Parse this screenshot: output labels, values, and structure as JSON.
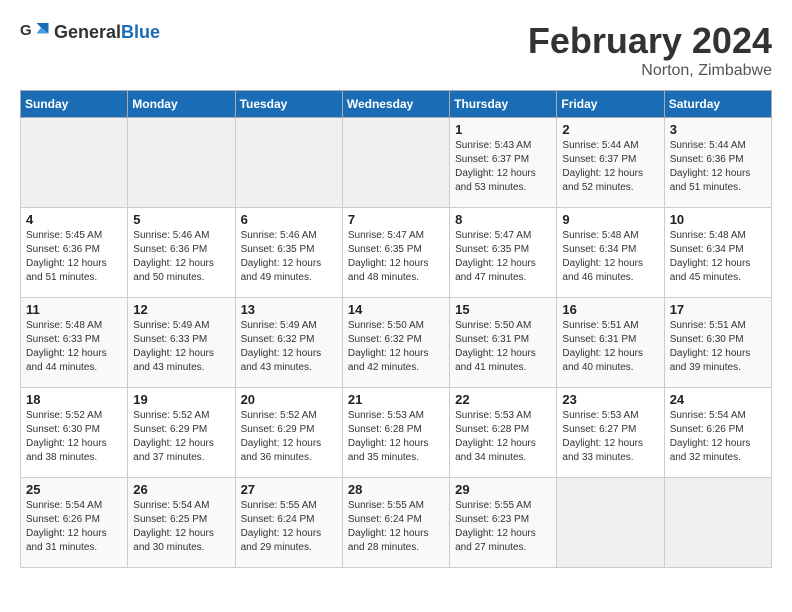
{
  "header": {
    "logo_general": "General",
    "logo_blue": "Blue",
    "month_title": "February 2024",
    "location": "Norton, Zimbabwe"
  },
  "days_of_week": [
    "Sunday",
    "Monday",
    "Tuesday",
    "Wednesday",
    "Thursday",
    "Friday",
    "Saturday"
  ],
  "weeks": [
    [
      {
        "day": "",
        "info": ""
      },
      {
        "day": "",
        "info": ""
      },
      {
        "day": "",
        "info": ""
      },
      {
        "day": "",
        "info": ""
      },
      {
        "day": "1",
        "info": "Sunrise: 5:43 AM\nSunset: 6:37 PM\nDaylight: 12 hours\nand 53 minutes."
      },
      {
        "day": "2",
        "info": "Sunrise: 5:44 AM\nSunset: 6:37 PM\nDaylight: 12 hours\nand 52 minutes."
      },
      {
        "day": "3",
        "info": "Sunrise: 5:44 AM\nSunset: 6:36 PM\nDaylight: 12 hours\nand 51 minutes."
      }
    ],
    [
      {
        "day": "4",
        "info": "Sunrise: 5:45 AM\nSunset: 6:36 PM\nDaylight: 12 hours\nand 51 minutes."
      },
      {
        "day": "5",
        "info": "Sunrise: 5:46 AM\nSunset: 6:36 PM\nDaylight: 12 hours\nand 50 minutes."
      },
      {
        "day": "6",
        "info": "Sunrise: 5:46 AM\nSunset: 6:35 PM\nDaylight: 12 hours\nand 49 minutes."
      },
      {
        "day": "7",
        "info": "Sunrise: 5:47 AM\nSunset: 6:35 PM\nDaylight: 12 hours\nand 48 minutes."
      },
      {
        "day": "8",
        "info": "Sunrise: 5:47 AM\nSunset: 6:35 PM\nDaylight: 12 hours\nand 47 minutes."
      },
      {
        "day": "9",
        "info": "Sunrise: 5:48 AM\nSunset: 6:34 PM\nDaylight: 12 hours\nand 46 minutes."
      },
      {
        "day": "10",
        "info": "Sunrise: 5:48 AM\nSunset: 6:34 PM\nDaylight: 12 hours\nand 45 minutes."
      }
    ],
    [
      {
        "day": "11",
        "info": "Sunrise: 5:48 AM\nSunset: 6:33 PM\nDaylight: 12 hours\nand 44 minutes."
      },
      {
        "day": "12",
        "info": "Sunrise: 5:49 AM\nSunset: 6:33 PM\nDaylight: 12 hours\nand 43 minutes."
      },
      {
        "day": "13",
        "info": "Sunrise: 5:49 AM\nSunset: 6:32 PM\nDaylight: 12 hours\nand 43 minutes."
      },
      {
        "day": "14",
        "info": "Sunrise: 5:50 AM\nSunset: 6:32 PM\nDaylight: 12 hours\nand 42 minutes."
      },
      {
        "day": "15",
        "info": "Sunrise: 5:50 AM\nSunset: 6:31 PM\nDaylight: 12 hours\nand 41 minutes."
      },
      {
        "day": "16",
        "info": "Sunrise: 5:51 AM\nSunset: 6:31 PM\nDaylight: 12 hours\nand 40 minutes."
      },
      {
        "day": "17",
        "info": "Sunrise: 5:51 AM\nSunset: 6:30 PM\nDaylight: 12 hours\nand 39 minutes."
      }
    ],
    [
      {
        "day": "18",
        "info": "Sunrise: 5:52 AM\nSunset: 6:30 PM\nDaylight: 12 hours\nand 38 minutes."
      },
      {
        "day": "19",
        "info": "Sunrise: 5:52 AM\nSunset: 6:29 PM\nDaylight: 12 hours\nand 37 minutes."
      },
      {
        "day": "20",
        "info": "Sunrise: 5:52 AM\nSunset: 6:29 PM\nDaylight: 12 hours\nand 36 minutes."
      },
      {
        "day": "21",
        "info": "Sunrise: 5:53 AM\nSunset: 6:28 PM\nDaylight: 12 hours\nand 35 minutes."
      },
      {
        "day": "22",
        "info": "Sunrise: 5:53 AM\nSunset: 6:28 PM\nDaylight: 12 hours\nand 34 minutes."
      },
      {
        "day": "23",
        "info": "Sunrise: 5:53 AM\nSunset: 6:27 PM\nDaylight: 12 hours\nand 33 minutes."
      },
      {
        "day": "24",
        "info": "Sunrise: 5:54 AM\nSunset: 6:26 PM\nDaylight: 12 hours\nand 32 minutes."
      }
    ],
    [
      {
        "day": "25",
        "info": "Sunrise: 5:54 AM\nSunset: 6:26 PM\nDaylight: 12 hours\nand 31 minutes."
      },
      {
        "day": "26",
        "info": "Sunrise: 5:54 AM\nSunset: 6:25 PM\nDaylight: 12 hours\nand 30 minutes."
      },
      {
        "day": "27",
        "info": "Sunrise: 5:55 AM\nSunset: 6:24 PM\nDaylight: 12 hours\nand 29 minutes."
      },
      {
        "day": "28",
        "info": "Sunrise: 5:55 AM\nSunset: 6:24 PM\nDaylight: 12 hours\nand 28 minutes."
      },
      {
        "day": "29",
        "info": "Sunrise: 5:55 AM\nSunset: 6:23 PM\nDaylight: 12 hours\nand 27 minutes."
      },
      {
        "day": "",
        "info": ""
      },
      {
        "day": "",
        "info": ""
      }
    ]
  ]
}
